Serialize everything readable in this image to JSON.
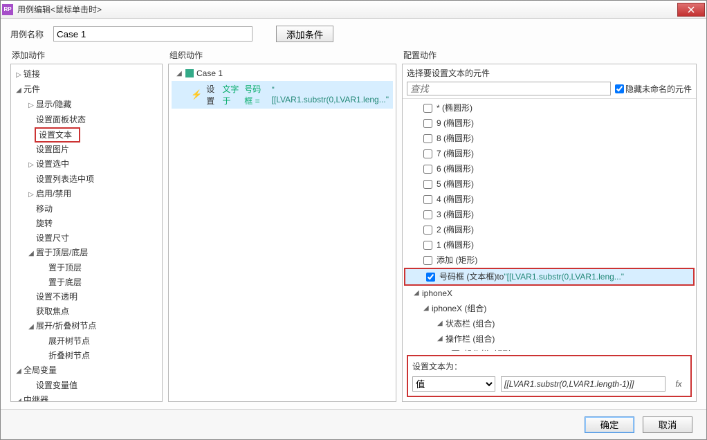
{
  "window": {
    "title": "用例编辑<鼠标单击时>"
  },
  "caseName": {
    "label": "用例名称",
    "value": "Case 1"
  },
  "addCondition": "添加条件",
  "columns": {
    "left": "添加动作",
    "mid": "组织动作",
    "right": "配置动作"
  },
  "leftTree": {
    "link": "链接",
    "widget": "元件",
    "showHide": "显示/隐藏",
    "panelState": "设置面板状态",
    "setText": "设置文本",
    "setImage": "设置图片",
    "setSelected": "设置选中",
    "setListSel": "设置列表选中项",
    "enableDisable": "启用/禁用",
    "move": "移动",
    "rotate": "旋转",
    "setSize": "设置尺寸",
    "layer": "置于顶层/底层",
    "toFront": "置于顶层",
    "toBack": "置于底层",
    "setOpacity": "设置不透明",
    "focus": "获取焦点",
    "treeNodes": "展开/折叠树节点",
    "expandNode": "展开树节点",
    "collapseNode": "折叠树节点",
    "globalVar": "全局变量",
    "setVar": "设置变量值",
    "repeater": "中继器"
  },
  "midTree": {
    "case": "Case 1",
    "action_pre": "设置",
    "action_mid": "文字于",
    "action_target": "号码框 =",
    "action_expr": "\"[[LVAR1.substr(0,LVAR1.leng...\""
  },
  "right": {
    "selectWidget": "选择要设置文本的元件",
    "searchPlaceholder": "查找",
    "hideUnnamed": "隐藏未命名的元件",
    "items": {
      "ellipseStar": "* (椭圆形)",
      "ellipse9": "9 (椭圆形)",
      "ellipse8": "8 (椭圆形)",
      "ellipse7": "7 (椭圆形)",
      "ellipse6": "6 (椭圆形)",
      "ellipse5": "5 (椭圆形)",
      "ellipse4": "4 (椭圆形)",
      "ellipse3": "3 (椭圆形)",
      "ellipse2": "2 (椭圆形)",
      "ellipse1": "1 (椭圆形)",
      "addRect": "添加 (矩形)",
      "numBox": "号码框 (文本框)",
      "numBoxTo": " to ",
      "numBoxExpr": "\"[[LVAR1.substr(0,LVAR1.leng...\"",
      "iphoneX": "iphoneX",
      "iphoneXGroup": "iphoneX (组合)",
      "statusBar": "状态栏 (组合)",
      "opsBar": "操作栏 (组合)",
      "opsRect": "操作栏 (矩形)"
    },
    "setTextAs": "设置文本为：",
    "valueOption": "值",
    "valueExpr": "[[LVAR1.substr(0,LVAR1.length-1)]]",
    "fx": "fx"
  },
  "footer": {
    "ok": "确定",
    "cancel": "取消"
  }
}
